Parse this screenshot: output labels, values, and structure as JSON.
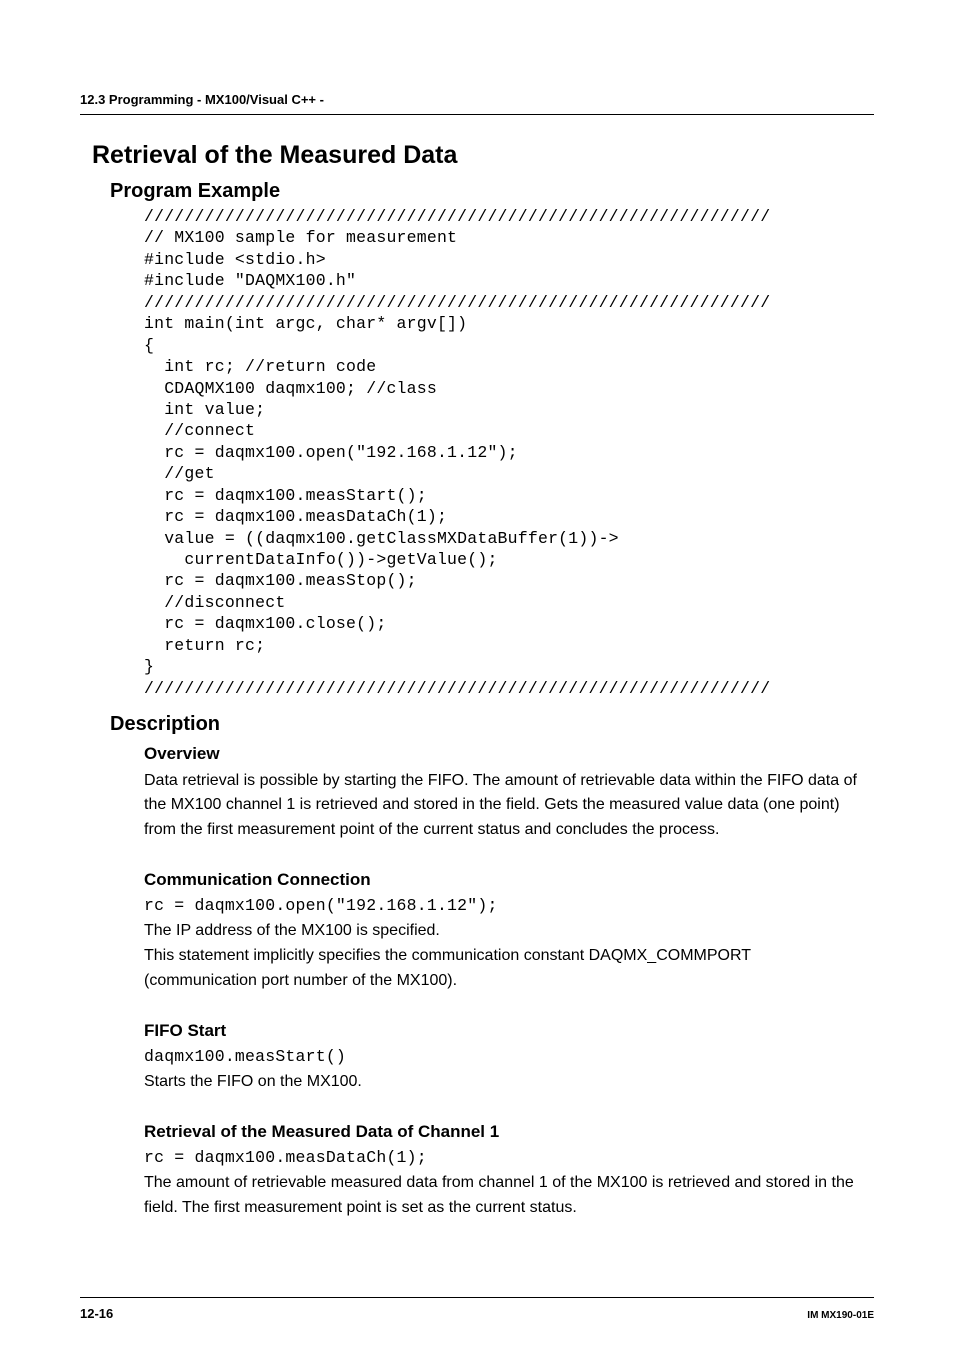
{
  "header": {
    "breadcrumb": "12.3  Programming - MX100/Visual C++ -"
  },
  "title": "Retrieval of the Measured Data",
  "program_example": {
    "heading": "Program Example",
    "code": "//////////////////////////////////////////////////////////////\n// MX100 sample for measurement\n#include <stdio.h>\n#include \"DAQMX100.h\"\n//////////////////////////////////////////////////////////////\nint main(int argc, char* argv[])\n{\n  int rc; //return code\n  CDAQMX100 daqmx100; //class\n  int value;\n  //connect\n  rc = daqmx100.open(\"192.168.1.12\");\n  //get\n  rc = daqmx100.measStart();\n  rc = daqmx100.measDataCh(1);\n  value = ((daqmx100.getClassMXDataBuffer(1))->\n    currentDataInfo())->getValue();\n  rc = daqmx100.measStop();\n  //disconnect\n  rc = daqmx100.close();\n  return rc;\n}\n//////////////////////////////////////////////////////////////"
  },
  "description": {
    "heading": "Description",
    "overview": {
      "heading": "Overview",
      "text": "Data retrieval is possible by starting the FIFO. The amount of retrievable data within the FIFO data of the MX100 channel 1 is retrieved and stored in the field. Gets the measured value data (one point) from the first measurement point of the current status and concludes the process."
    },
    "comm": {
      "heading": "Communication Connection",
      "code": "rc = daqmx100.open(\"192.168.1.12\");",
      "text1": "The IP address of the MX100 is specified.",
      "text2": "This statement implicitly specifies the communication constant DAQMX_COMMPORT (communication port number of the MX100)."
    },
    "fifo": {
      "heading": "FIFO Start",
      "code": "daqmx100.measStart()",
      "text": "Starts the FIFO on the MX100."
    },
    "retrieval": {
      "heading": "Retrieval of the Measured Data of Channel 1",
      "code": "rc = daqmx100.measDataCh(1);",
      "text": "The amount of retrievable measured data from channel 1 of the MX100 is retrieved and stored in the field. The first measurement point is set as the current status."
    }
  },
  "footer": {
    "page": "12-16",
    "doc": "IM MX190-01E"
  }
}
